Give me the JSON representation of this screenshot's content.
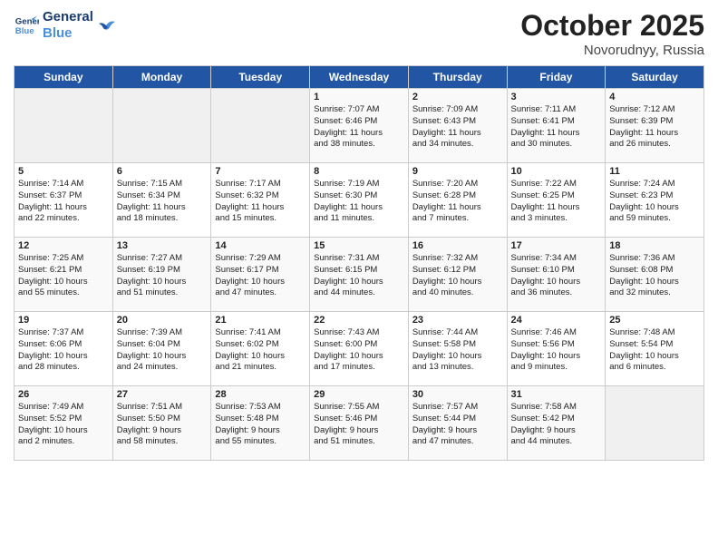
{
  "header": {
    "logo_line1": "General",
    "logo_line2": "Blue",
    "month": "October 2025",
    "location": "Novorudnyy, Russia"
  },
  "days_of_week": [
    "Sunday",
    "Monday",
    "Tuesday",
    "Wednesday",
    "Thursday",
    "Friday",
    "Saturday"
  ],
  "weeks": [
    [
      {
        "day": "",
        "info": ""
      },
      {
        "day": "",
        "info": ""
      },
      {
        "day": "",
        "info": ""
      },
      {
        "day": "1",
        "info": "Sunrise: 7:07 AM\nSunset: 6:46 PM\nDaylight: 11 hours\nand 38 minutes."
      },
      {
        "day": "2",
        "info": "Sunrise: 7:09 AM\nSunset: 6:43 PM\nDaylight: 11 hours\nand 34 minutes."
      },
      {
        "day": "3",
        "info": "Sunrise: 7:11 AM\nSunset: 6:41 PM\nDaylight: 11 hours\nand 30 minutes."
      },
      {
        "day": "4",
        "info": "Sunrise: 7:12 AM\nSunset: 6:39 PM\nDaylight: 11 hours\nand 26 minutes."
      }
    ],
    [
      {
        "day": "5",
        "info": "Sunrise: 7:14 AM\nSunset: 6:37 PM\nDaylight: 11 hours\nand 22 minutes."
      },
      {
        "day": "6",
        "info": "Sunrise: 7:15 AM\nSunset: 6:34 PM\nDaylight: 11 hours\nand 18 minutes."
      },
      {
        "day": "7",
        "info": "Sunrise: 7:17 AM\nSunset: 6:32 PM\nDaylight: 11 hours\nand 15 minutes."
      },
      {
        "day": "8",
        "info": "Sunrise: 7:19 AM\nSunset: 6:30 PM\nDaylight: 11 hours\nand 11 minutes."
      },
      {
        "day": "9",
        "info": "Sunrise: 7:20 AM\nSunset: 6:28 PM\nDaylight: 11 hours\nand 7 minutes."
      },
      {
        "day": "10",
        "info": "Sunrise: 7:22 AM\nSunset: 6:25 PM\nDaylight: 11 hours\nand 3 minutes."
      },
      {
        "day": "11",
        "info": "Sunrise: 7:24 AM\nSunset: 6:23 PM\nDaylight: 10 hours\nand 59 minutes."
      }
    ],
    [
      {
        "day": "12",
        "info": "Sunrise: 7:25 AM\nSunset: 6:21 PM\nDaylight: 10 hours\nand 55 minutes."
      },
      {
        "day": "13",
        "info": "Sunrise: 7:27 AM\nSunset: 6:19 PM\nDaylight: 10 hours\nand 51 minutes."
      },
      {
        "day": "14",
        "info": "Sunrise: 7:29 AM\nSunset: 6:17 PM\nDaylight: 10 hours\nand 47 minutes."
      },
      {
        "day": "15",
        "info": "Sunrise: 7:31 AM\nSunset: 6:15 PM\nDaylight: 10 hours\nand 44 minutes."
      },
      {
        "day": "16",
        "info": "Sunrise: 7:32 AM\nSunset: 6:12 PM\nDaylight: 10 hours\nand 40 minutes."
      },
      {
        "day": "17",
        "info": "Sunrise: 7:34 AM\nSunset: 6:10 PM\nDaylight: 10 hours\nand 36 minutes."
      },
      {
        "day": "18",
        "info": "Sunrise: 7:36 AM\nSunset: 6:08 PM\nDaylight: 10 hours\nand 32 minutes."
      }
    ],
    [
      {
        "day": "19",
        "info": "Sunrise: 7:37 AM\nSunset: 6:06 PM\nDaylight: 10 hours\nand 28 minutes."
      },
      {
        "day": "20",
        "info": "Sunrise: 7:39 AM\nSunset: 6:04 PM\nDaylight: 10 hours\nand 24 minutes."
      },
      {
        "day": "21",
        "info": "Sunrise: 7:41 AM\nSunset: 6:02 PM\nDaylight: 10 hours\nand 21 minutes."
      },
      {
        "day": "22",
        "info": "Sunrise: 7:43 AM\nSunset: 6:00 PM\nDaylight: 10 hours\nand 17 minutes."
      },
      {
        "day": "23",
        "info": "Sunrise: 7:44 AM\nSunset: 5:58 PM\nDaylight: 10 hours\nand 13 minutes."
      },
      {
        "day": "24",
        "info": "Sunrise: 7:46 AM\nSunset: 5:56 PM\nDaylight: 10 hours\nand 9 minutes."
      },
      {
        "day": "25",
        "info": "Sunrise: 7:48 AM\nSunset: 5:54 PM\nDaylight: 10 hours\nand 6 minutes."
      }
    ],
    [
      {
        "day": "26",
        "info": "Sunrise: 7:49 AM\nSunset: 5:52 PM\nDaylight: 10 hours\nand 2 minutes."
      },
      {
        "day": "27",
        "info": "Sunrise: 7:51 AM\nSunset: 5:50 PM\nDaylight: 9 hours\nand 58 minutes."
      },
      {
        "day": "28",
        "info": "Sunrise: 7:53 AM\nSunset: 5:48 PM\nDaylight: 9 hours\nand 55 minutes."
      },
      {
        "day": "29",
        "info": "Sunrise: 7:55 AM\nSunset: 5:46 PM\nDaylight: 9 hours\nand 51 minutes."
      },
      {
        "day": "30",
        "info": "Sunrise: 7:57 AM\nSunset: 5:44 PM\nDaylight: 9 hours\nand 47 minutes."
      },
      {
        "day": "31",
        "info": "Sunrise: 7:58 AM\nSunset: 5:42 PM\nDaylight: 9 hours\nand 44 minutes."
      },
      {
        "day": "",
        "info": ""
      }
    ]
  ]
}
